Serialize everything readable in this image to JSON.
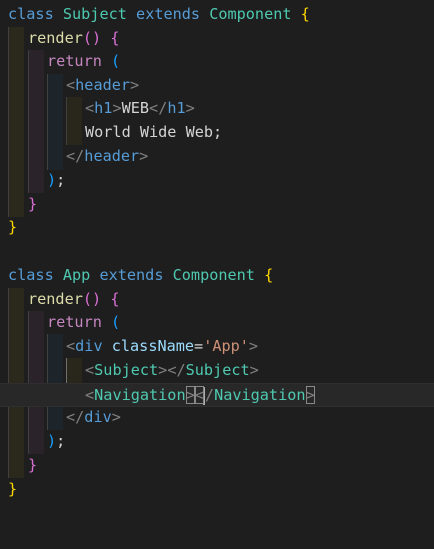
{
  "editor": {
    "block1": {
      "l1_class": "class",
      "l1_name": "Subject",
      "l1_extends": "extends",
      "l1_base": "Component",
      "l1_brace": "{",
      "l2_method": "render",
      "l2_parens": "()",
      "l2_brace": "{",
      "l3_return": "return",
      "l3_paren": "(",
      "l4_open": "<",
      "l4_tag": "header",
      "l4_close": ">",
      "l5_open": "<",
      "l5_tag": "h1",
      "l5_close": ">",
      "l5_text": "WEB",
      "l5_open2": "</",
      "l5_tag2": "h1",
      "l5_close2": ">",
      "l6_text": "World Wide Web;",
      "l7_open": "</",
      "l7_tag": "header",
      "l7_close": ">",
      "l8_paren": ")",
      "l8_semi": ";",
      "l9_brace": "}",
      "l10_brace": "}"
    },
    "block2": {
      "l1_class": "class",
      "l1_name": "App",
      "l1_extends": "extends",
      "l1_base": "Component",
      "l1_brace": "{",
      "l2_method": "render",
      "l2_parens": "()",
      "l2_brace": "{",
      "l3_return": "return",
      "l3_paren": "(",
      "l4_open": "<",
      "l4_tag": "div",
      "l4_attr": "className",
      "l4_eq": "=",
      "l4_value": "'App'",
      "l4_close": ">",
      "l5_open": "<",
      "l5_tag": "Subject",
      "l5_close": ">",
      "l5_open2": "</",
      "l5_tag2": "Subject",
      "l5_close2": ">",
      "l6_open": "<",
      "l6_tag": "Navigation",
      "l6_close": ">",
      "l6_open2": "<",
      "l6_slash": "/",
      "l6_tag2": "Navigation",
      "l6_close2": ">",
      "l7_open": "</",
      "l7_tag": "div",
      "l7_close": ">",
      "l8_paren": ")",
      "l8_semi": ";",
      "l9_brace": "}",
      "l10_brace": "}"
    }
  },
  "colors": {
    "background": "#1e1e1e",
    "keyword": "#569cd6",
    "control": "#c586c0",
    "class_name": "#4ec9b0",
    "function": "#dcdcaa",
    "bracket_level1": "#ffd700",
    "bracket_level2": "#da70d6",
    "bracket_level3": "#179fff",
    "tag_punctuation": "#808080",
    "attribute": "#9cdcfe",
    "string": "#ce9178",
    "text": "#d4d4d4"
  }
}
